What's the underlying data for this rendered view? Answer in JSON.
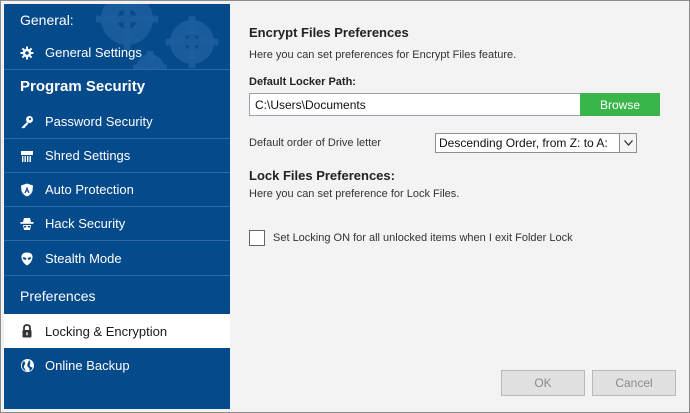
{
  "sidebar": {
    "general_header": "General:",
    "general_settings": "General Settings",
    "program_security_header": "Program Security",
    "items": [
      {
        "label": "Password Security",
        "icon": "key-icon"
      },
      {
        "label": "Shred Settings",
        "icon": "shredder-icon"
      },
      {
        "label": "Auto Protection",
        "icon": "shield-a-icon"
      },
      {
        "label": "Hack Security",
        "icon": "spy-icon"
      },
      {
        "label": "Stealth Mode",
        "icon": "alien-icon"
      }
    ],
    "preferences_header": "Preferences",
    "pref_items": [
      {
        "label": "Locking & Encryption",
        "icon": "lock-icon",
        "active": true
      },
      {
        "label": "Online Backup",
        "icon": "globe-icon",
        "active": false
      }
    ]
  },
  "main": {
    "encrypt_title": "Encrypt Files Preferences",
    "encrypt_desc": "Here you can set preferences for Encrypt Files feature.",
    "locker_path_label": "Default Locker Path:",
    "locker_path_value": "C:\\Users\\Documents",
    "browse_label": "Browse",
    "drive_order_label": "Default order of Drive letter",
    "drive_order_selected": "Descending Order, from Z: to A:",
    "lock_title": "Lock Files Preferences:",
    "lock_desc": "Here you can set preference for Lock Files.",
    "locking_checkbox_label": "Set Locking ON for all unlocked items when I exit Folder Lock",
    "locking_checkbox_checked": false,
    "ok_label": "OK",
    "cancel_label": "Cancel"
  },
  "colors": {
    "sidebar_bg": "#054a8b",
    "browse_bg": "#3ab54a",
    "active_item_bg": "#ffffff"
  }
}
